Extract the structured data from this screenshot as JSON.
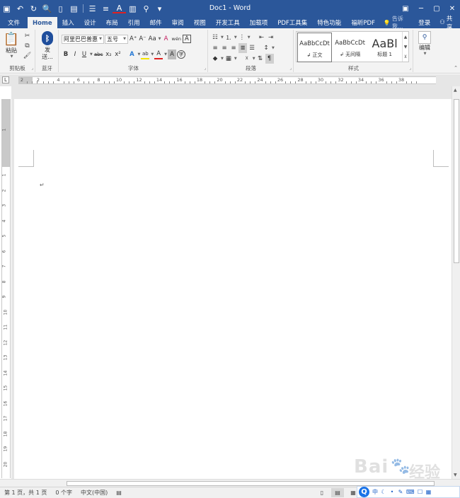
{
  "window": {
    "title": "Doc1 - Word",
    "minimize_glyph": "─",
    "restore_glyph": "▢",
    "close_glyph": "✕"
  },
  "qat": {
    "save_glyph": "▣",
    "undo_glyph": "↶",
    "redo_glyph": "↻",
    "print_preview_glyph": "🔍",
    "new_glyph": "▯",
    "paste_glyph": "▤",
    "layout_glyph": "☰",
    "align_glyph": "≡",
    "font_color_glyph": "A",
    "columns_glyph": "▥",
    "find_glyph": "⚲",
    "more_glyph": "▾"
  },
  "tabs": [
    "文件",
    "Home",
    "插入",
    "设计",
    "布局",
    "引用",
    "邮件",
    "审阅",
    "视图",
    "开发工具",
    "加载项",
    "PDF工具集",
    "特色功能",
    "福昕PDF"
  ],
  "active_tab": "Home",
  "tell_me": "告诉我...",
  "signin": "登录",
  "share": "共享",
  "clipboard": {
    "paste_label": "粘贴",
    "group_label": "剪贴板"
  },
  "bluetooth": {
    "send_label": "发\n送...",
    "group_label": "蓝牙"
  },
  "font": {
    "name": "阿里巴巴普惠",
    "size": "五号",
    "group_label": "字体",
    "bold": "B",
    "italic": "I",
    "underline": "U",
    "strike": "abc",
    "sub": "x₂",
    "sup": "x²",
    "grow": "A⁺",
    "shrink": "A⁻",
    "case": "Aa",
    "clear": "A",
    "phonetic": "wén",
    "border_char": "A",
    "effects": "A",
    "highlight": "ab",
    "color": "A",
    "shade_char": "A",
    "enclose": "字"
  },
  "paragraph": {
    "group_label": "段落"
  },
  "styles": {
    "group_label": "样式",
    "items": [
      {
        "sample": "AaBbCcDt",
        "name": "↲ 正文"
      },
      {
        "sample": "AaBbCcDt",
        "name": "↲ 无间隔"
      },
      {
        "sample": "AaBl",
        "name": "标题 1"
      }
    ]
  },
  "editing": {
    "label": "编辑"
  },
  "ruler_h": [
    "2",
    "2",
    "4",
    "6",
    "8",
    "10",
    "12",
    "14",
    "16",
    "18",
    "20",
    "22",
    "24",
    "26",
    "28",
    "30",
    "32",
    "34",
    "36",
    "38"
  ],
  "ruler_v": [
    "1",
    "1",
    "2",
    "3",
    "4",
    "5",
    "6",
    "7",
    "8",
    "9",
    "10",
    "11",
    "12",
    "13",
    "14",
    "15",
    "16",
    "17",
    "18",
    "19",
    "20"
  ],
  "ruler_corner": "L",
  "paragraph_mark": "↵",
  "status": {
    "page": "第 1 页，共 1 页",
    "words": "0 个字",
    "language": "中文(中国)"
  },
  "ime": {
    "logo": "Q",
    "mode": "中"
  },
  "watermark": {
    "brand": "Bai",
    "suffix": "经验"
  }
}
